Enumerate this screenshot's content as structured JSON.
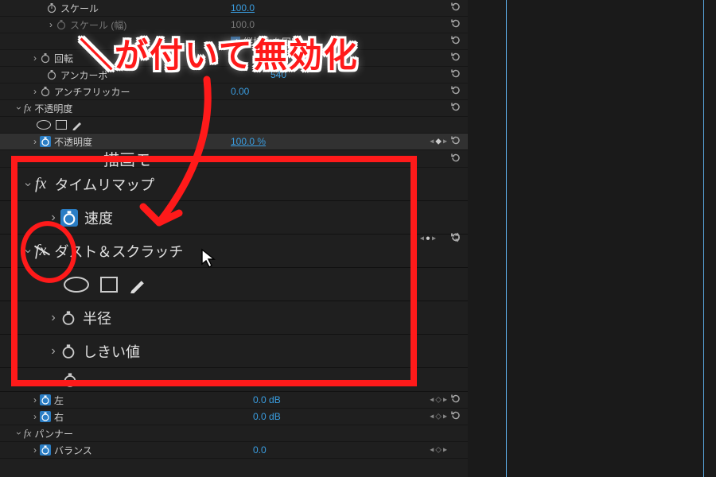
{
  "rows": {
    "scale": {
      "label": "スケール",
      "value": "100.0"
    },
    "scale_h": {
      "label": "スケール (幅)",
      "value": "100.0"
    },
    "lock_aspect": {
      "label": "縦横比を固定"
    },
    "rotation": {
      "label": "回転"
    },
    "anchor": {
      "label": "アンカーポ",
      "value": "540"
    },
    "antiflicker": {
      "label": "アンチフリッカー",
      "value": "0.00"
    },
    "opacity_group": "不透明度",
    "opacity": {
      "label": "不透明度",
      "value": "100.0 %"
    },
    "blend": {
      "label": "描画モ"
    },
    "timeremap_group": "タイムリマップ",
    "speed": {
      "label": "速度"
    },
    "dust_group": "ダスト＆スクラッチ",
    "radius": {
      "label": "半径"
    },
    "threshold": {
      "label": "しきい値"
    },
    "left": {
      "label": "左",
      "value": "0.0 dB"
    },
    "right": {
      "label": "右",
      "value": "0.0 dB"
    },
    "panner_group": "パンナー",
    "balance": {
      "label": "バランス",
      "value": "0.0"
    }
  },
  "annotation": "＼が付いて無効化"
}
